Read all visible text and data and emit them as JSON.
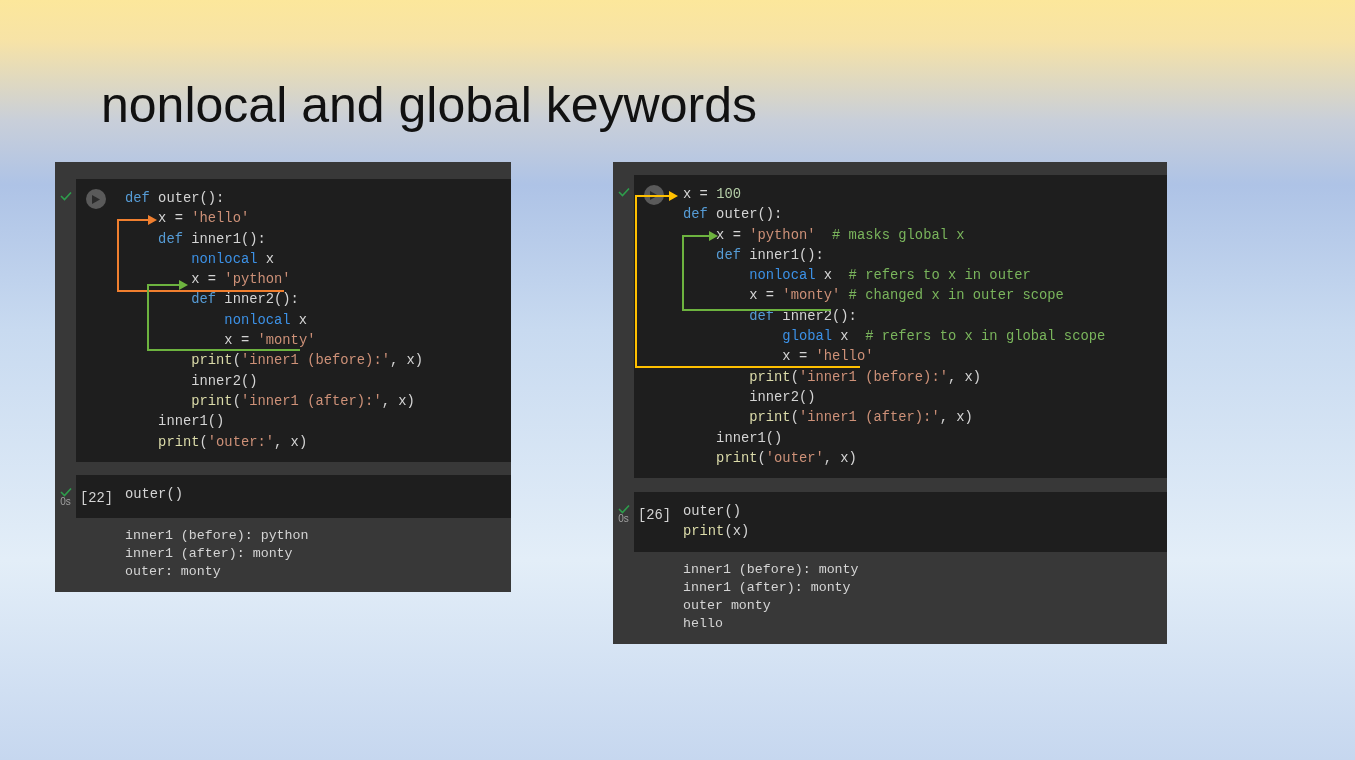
{
  "title": "nonlocal and global keywords",
  "panels": [
    {
      "cells": [
        {
          "succeeded": true,
          "show_run_button": true,
          "code": [
            [
              {
                "kind": "kw",
                "text": "def"
              },
              {
                "kind": "plain",
                "text": " outer():"
              }
            ],
            [
              {
                "kind": "plain",
                "text": "    x = "
              },
              {
                "kind": "str",
                "text": "'hello'"
              }
            ],
            [
              {
                "kind": "kw",
                "text": "    def"
              },
              {
                "kind": "plain",
                "text": " inner1():"
              }
            ],
            [
              {
                "kind": "kw2",
                "text": "        nonlocal"
              },
              {
                "kind": "plain",
                "text": " x"
              }
            ],
            [
              {
                "kind": "plain",
                "text": "        x = "
              },
              {
                "kind": "str",
                "text": "'python'"
              }
            ],
            [
              {
                "kind": "kw",
                "text": "        def"
              },
              {
                "kind": "plain",
                "text": " inner2():"
              }
            ],
            [
              {
                "kind": "kw2",
                "text": "            nonlocal"
              },
              {
                "kind": "plain",
                "text": " x"
              }
            ],
            [
              {
                "kind": "plain",
                "text": "            x = "
              },
              {
                "kind": "str",
                "text": "'monty'"
              }
            ],
            [
              {
                "kind": "func",
                "text": "        print"
              },
              {
                "kind": "plain",
                "text": "("
              },
              {
                "kind": "str",
                "text": "'inner1 (before):'"
              },
              {
                "kind": "plain",
                "text": ", x)"
              }
            ],
            [
              {
                "kind": "plain",
                "text": "        inner2()"
              }
            ],
            [
              {
                "kind": "func",
                "text": "        print"
              },
              {
                "kind": "plain",
                "text": "("
              },
              {
                "kind": "str",
                "text": "'inner1 (after):'"
              },
              {
                "kind": "plain",
                "text": ", x)"
              }
            ],
            [
              {
                "kind": "plain",
                "text": "    inner1()"
              }
            ],
            [
              {
                "kind": "func",
                "text": "    print"
              },
              {
                "kind": "plain",
                "text": "("
              },
              {
                "kind": "str",
                "text": "'outer:'"
              },
              {
                "kind": "plain",
                "text": ", x)"
              }
            ]
          ]
        },
        {
          "succeeded": true,
          "execution_count": "[22]",
          "elapsed": "0s",
          "code": [
            [
              {
                "kind": "plain",
                "text": "outer()"
              }
            ]
          ],
          "output": [
            "inner1 (before): python",
            "inner1 (after): monty",
            "outer: monty"
          ]
        }
      ],
      "arrows": [
        {
          "color": "#f07f2f"
        },
        {
          "color": "#6db33f"
        }
      ]
    },
    {
      "cells": [
        {
          "succeeded": true,
          "show_run_button": true,
          "code": [
            [
              {
                "kind": "plain",
                "text": "x = "
              },
              {
                "kind": "num",
                "text": "100"
              }
            ],
            [
              {
                "kind": "kw",
                "text": "def"
              },
              {
                "kind": "plain",
                "text": " outer():"
              }
            ],
            [
              {
                "kind": "plain",
                "text": "    x = "
              },
              {
                "kind": "str",
                "text": "'python'"
              },
              {
                "kind": "com",
                "text": "  # masks global x"
              }
            ],
            [
              {
                "kind": "kw",
                "text": "    def"
              },
              {
                "kind": "plain",
                "text": " inner1():"
              }
            ],
            [
              {
                "kind": "kw2",
                "text": "        nonlocal"
              },
              {
                "kind": "plain",
                "text": " x  "
              },
              {
                "kind": "com",
                "text": "# refers to x in outer"
              }
            ],
            [
              {
                "kind": "plain",
                "text": "        x = "
              },
              {
                "kind": "str",
                "text": "'monty'"
              },
              {
                "kind": "com",
                "text": " # changed x in outer scope"
              }
            ],
            [
              {
                "kind": "kw",
                "text": "        def"
              },
              {
                "kind": "plain",
                "text": " inner2():"
              }
            ],
            [
              {
                "kind": "kw2",
                "text": "            global"
              },
              {
                "kind": "plain",
                "text": " x  "
              },
              {
                "kind": "com",
                "text": "# refers to x in global scope"
              }
            ],
            [
              {
                "kind": "plain",
                "text": "            x = "
              },
              {
                "kind": "str",
                "text": "'hello'"
              }
            ],
            [
              {
                "kind": "func",
                "text": "        print"
              },
              {
                "kind": "plain",
                "text": "("
              },
              {
                "kind": "str",
                "text": "'inner1 (before):'"
              },
              {
                "kind": "plain",
                "text": ", x)"
              }
            ],
            [
              {
                "kind": "plain",
                "text": "        inner2()"
              }
            ],
            [
              {
                "kind": "func",
                "text": "        print"
              },
              {
                "kind": "plain",
                "text": "("
              },
              {
                "kind": "str",
                "text": "'inner1 (after):'"
              },
              {
                "kind": "plain",
                "text": ", x)"
              }
            ],
            [
              {
                "kind": "plain",
                "text": "    inner1()"
              }
            ],
            [
              {
                "kind": "func",
                "text": "    print"
              },
              {
                "kind": "plain",
                "text": "("
              },
              {
                "kind": "str",
                "text": "'outer'"
              },
              {
                "kind": "plain",
                "text": ", x)"
              }
            ]
          ]
        },
        {
          "succeeded": true,
          "execution_count": "[26]",
          "elapsed": "0s",
          "code": [
            [
              {
                "kind": "plain",
                "text": "outer()"
              }
            ],
            [
              {
                "kind": "func",
                "text": "print"
              },
              {
                "kind": "plain",
                "text": "(x)"
              }
            ]
          ],
          "output": [
            "inner1 (before): monty",
            "inner1 (after): monty",
            "outer monty",
            "hello"
          ]
        }
      ],
      "arrows": [
        {
          "color": "#ffc000"
        },
        {
          "color": "#6db33f"
        }
      ]
    }
  ]
}
